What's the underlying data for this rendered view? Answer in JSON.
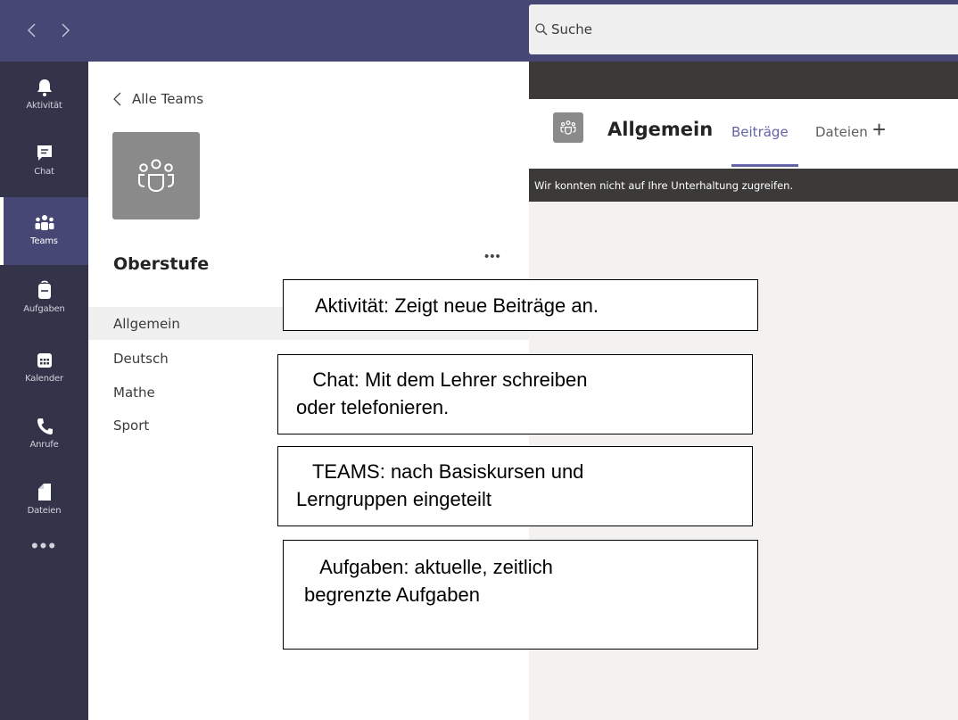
{
  "topbar": {
    "back_arrow": "‹",
    "forward_arrow": "›",
    "search_placeholder": "Suche"
  },
  "rail": {
    "items": [
      {
        "label": "Aktivität",
        "icon": "bell-icon"
      },
      {
        "label": "Chat",
        "icon": "chat-icon"
      },
      {
        "label": "Teams",
        "icon": "teams-icon",
        "active": true
      },
      {
        "label": "Aufgaben",
        "icon": "assignments-icon"
      },
      {
        "label": "Kalender",
        "icon": "calendar-icon"
      },
      {
        "label": "Anrufe",
        "icon": "phone-icon"
      },
      {
        "label": "Dateien",
        "icon": "file-icon"
      }
    ],
    "more": "•••"
  },
  "panel": {
    "back_label": "Alle Teams",
    "team_name": "Oberstufe",
    "team_more": "•••",
    "channels": [
      {
        "label": "Allgemein",
        "active": true
      },
      {
        "label": "Deutsch"
      },
      {
        "label": "Mathe"
      },
      {
        "label": "Sport"
      }
    ]
  },
  "channel_header": {
    "title": "Allgemein",
    "tabs": [
      "Beiträge",
      "Dateien"
    ],
    "add_tab": "+"
  },
  "error_banner": "Wir konnten nicht auf Ihre Unterhaltung zugreifen.",
  "notes": [
    {
      "lines": [
        "  Aktivität: Zeigt neue Beiträge an."
      ]
    },
    {
      "lines": [
        "   Chat: Mit dem Lehrer schreiben",
        "oder telefonieren."
      ]
    },
    {
      "lines": [
        "   TEAMS: nach Basiskursen und",
        "Lerngruppen eingeteilt"
      ]
    },
    {
      "lines": [
        "   Aufgaben: aktuelle, zeitlich",
        "begrenzte Aufgaben"
      ]
    }
  ],
  "colors": {
    "topbar": "#464775",
    "rail": "#33344a",
    "accent": "#6264a7",
    "content_bg": "#f3f2f1",
    "banner": "#3b3a39"
  }
}
